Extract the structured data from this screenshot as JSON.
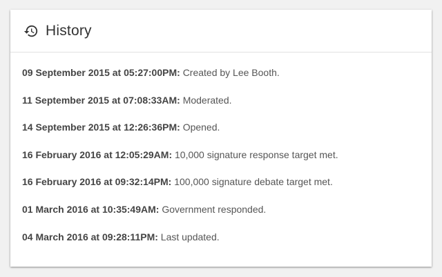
{
  "card": {
    "title": "History",
    "icon": "history-icon"
  },
  "history": [
    {
      "timestamp": "09 September 2015 at 05:27:00PM:",
      "event": "Created by Lee Booth."
    },
    {
      "timestamp": "11 September 2015 at 07:08:33AM:",
      "event": "Moderated."
    },
    {
      "timestamp": "14 September 2015 at 12:26:36PM:",
      "event": "Opened."
    },
    {
      "timestamp": "16 February 2016 at 12:05:29AM:",
      "event": "10,000 signature response target met."
    },
    {
      "timestamp": "16 February 2016 at 09:32:14PM:",
      "event": "100,000 signature debate target met."
    },
    {
      "timestamp": "01 March 2016 at 10:35:49AM:",
      "event": "Government responded."
    },
    {
      "timestamp": "04 March 2016 at 09:28:11PM:",
      "event": "Last updated."
    }
  ],
  "colors": {
    "background": "#f1f1f1",
    "card": "#ffffff",
    "text": "#555555",
    "timestamp": "#444444"
  }
}
